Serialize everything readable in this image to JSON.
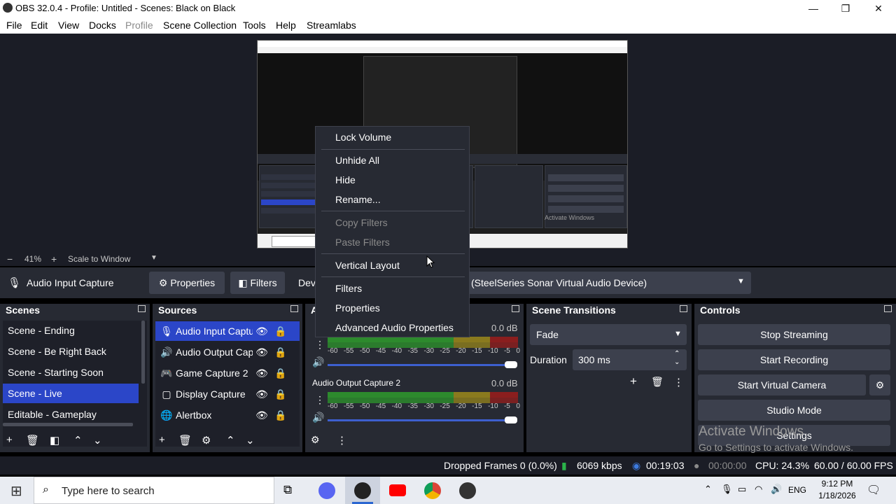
{
  "window": {
    "title": "OBS 32.0.4 - Profile: Untitled - Scenes: Black on Black",
    "minimize_glyph": "—",
    "restore_glyph": "❐",
    "close_glyph": "✕"
  },
  "menu": [
    "File",
    "Edit",
    "View",
    "Docks",
    "Profile",
    "Scene Collection",
    "Tools",
    "Help",
    "Streamlabs"
  ],
  "menu_disabled": [
    "Profile"
  ],
  "preview": {
    "zoom_minus": "−",
    "zoom_value": "41%",
    "zoom_plus": "+",
    "scale_mode": "Scale to Window",
    "nested_watermark": "Activate Windows"
  },
  "source_toolbar": {
    "selected_source": "Audio Input Capture",
    "properties_label": "Properties",
    "filters_label": "Filters",
    "device_label_partial": "Dev",
    "device_value": "(SteelSeries Sonar Virtual Audio Device)"
  },
  "scenes": {
    "header": "Scenes",
    "items": [
      "Scene - Ending",
      "Scene - Be Right Back",
      "Scene - Starting Soon",
      "Scene - Live",
      "Editable - Gameplay"
    ],
    "selected": "Scene - Live"
  },
  "sources": {
    "header": "Sources",
    "items": [
      {
        "label": "Audio Input Captu",
        "icon": "microphone-icon",
        "glyph": "🎙",
        "locked": false
      },
      {
        "label": "Audio Output Cap",
        "icon": "speaker-icon",
        "glyph": "🔊",
        "locked": false
      },
      {
        "label": "Game Capture 2",
        "icon": "gamepad-icon",
        "glyph": "🎮",
        "locked": true
      },
      {
        "label": "Display Capture",
        "icon": "monitor-icon",
        "glyph": "▢",
        "locked": true
      },
      {
        "label": "Alertbox",
        "icon": "globe-icon",
        "glyph": "🌐",
        "locked": false
      }
    ],
    "selected": "Audio Input Captu"
  },
  "mixer": {
    "header_partial": "A",
    "channels": [
      {
        "name": "",
        "db": "0.0 dB",
        "volume": 1.0
      },
      {
        "name": "Audio Output Capture 2",
        "db": "0.0 dB",
        "volume": 1.0
      }
    ],
    "ticks": [
      "-60",
      "-55",
      "-50",
      "-45",
      "-40",
      "-35",
      "-30",
      "-25",
      "-20",
      "-15",
      "-10",
      "-5",
      "0"
    ]
  },
  "scene_transitions": {
    "header": "Scene Transitions",
    "transition": "Fade",
    "duration_label": "Duration",
    "duration_value": "300 ms"
  },
  "controls": {
    "header": "Controls",
    "stop_streaming": "Stop Streaming",
    "start_recording": "Start Recording",
    "start_virtual_camera": "Start Virtual Camera",
    "studio_mode": "Studio Mode",
    "settings": "Settings",
    "activate_title": "Activate Windows",
    "activate_sub": "Go to Settings to activate Windows."
  },
  "context_menu": {
    "lock_volume": "Lock Volume",
    "unhide_all": "Unhide All",
    "hide": "Hide",
    "rename": "Rename...",
    "copy_filters": "Copy Filters",
    "paste_filters": "Paste Filters",
    "vertical_layout": "Vertical Layout",
    "filters": "Filters",
    "properties": "Properties",
    "advanced_audio": "Advanced Audio Properties"
  },
  "status": {
    "dropped_frames": "Dropped Frames 0 (0.0%)",
    "bitrate": "6069 kbps",
    "stream_time": "00:19:03",
    "record_time": "00:00:00",
    "cpu": "CPU: 24.3%",
    "fps": "60.00 / 60.00 FPS"
  },
  "taskbar": {
    "search_placeholder": "Type here to search",
    "language": "ENG",
    "time": "9:12 PM",
    "date": "1/18/2026"
  },
  "colors": {
    "accent": "#2b46c8",
    "panel": "#272a33",
    "meter_green": "#2d8a2d",
    "meter_yellow": "#8a7a1e",
    "meter_red": "#8a1e1e"
  }
}
